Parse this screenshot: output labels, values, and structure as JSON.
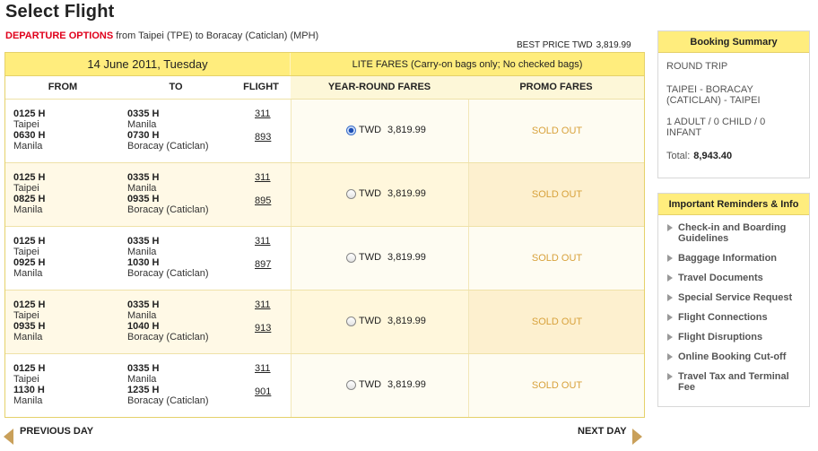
{
  "page": {
    "title": "Select Flight"
  },
  "departure": {
    "label": "DEPARTURE OPTIONS",
    "route": " from Taipei (TPE) to Boracay (Caticlan) (MPH)"
  },
  "best_price": {
    "label": "BEST PRICE TWD",
    "value": "3,819.99"
  },
  "table": {
    "date": "14 June 2011, Tuesday",
    "lite_fares": "LITE FARES (Carry-on bags only; No checked bags)",
    "headers": {
      "from": "FROM",
      "to": "TO",
      "flight": "FLIGHT",
      "year_round": "YEAR-ROUND FARES",
      "promo": "PROMO FARES"
    },
    "rows": [
      {
        "dep1_time": "0125 H",
        "dep1_city": "Taipei",
        "dep2_time": "0630 H",
        "dep2_city": "Manila",
        "arr1_time": "0335 H",
        "arr1_city": "Manila",
        "arr2_time": "0730 H",
        "arr2_city": "Boracay (Caticlan)",
        "flight1": "311",
        "flight2": "893",
        "currency": "TWD",
        "fare": "3,819.99",
        "selected": true,
        "promo": "SOLD OUT"
      },
      {
        "dep1_time": "0125 H",
        "dep1_city": "Taipei",
        "dep2_time": "0825 H",
        "dep2_city": "Manila",
        "arr1_time": "0335 H",
        "arr1_city": "Manila",
        "arr2_time": "0935 H",
        "arr2_city": "Boracay (Caticlan)",
        "flight1": "311",
        "flight2": "895",
        "currency": "TWD",
        "fare": "3,819.99",
        "selected": false,
        "promo": "SOLD OUT"
      },
      {
        "dep1_time": "0125 H",
        "dep1_city": "Taipei",
        "dep2_time": "0925 H",
        "dep2_city": "Manila",
        "arr1_time": "0335 H",
        "arr1_city": "Manila",
        "arr2_time": "1030 H",
        "arr2_city": "Boracay (Caticlan)",
        "flight1": "311",
        "flight2": "897",
        "currency": "TWD",
        "fare": "3,819.99",
        "selected": false,
        "promo": "SOLD OUT"
      },
      {
        "dep1_time": "0125 H",
        "dep1_city": "Taipei",
        "dep2_time": "0935 H",
        "dep2_city": "Manila",
        "arr1_time": "0335 H",
        "arr1_city": "Manila",
        "arr2_time": "1040 H",
        "arr2_city": "Boracay (Caticlan)",
        "flight1": "311",
        "flight2": "913",
        "currency": "TWD",
        "fare": "3,819.99",
        "selected": false,
        "promo": "SOLD OUT"
      },
      {
        "dep1_time": "0125 H",
        "dep1_city": "Taipei",
        "dep2_time": "1130 H",
        "dep2_city": "Manila",
        "arr1_time": "0335 H",
        "arr1_city": "Manila",
        "arr2_time": "1235 H",
        "arr2_city": "Boracay (Caticlan)",
        "flight1": "311",
        "flight2": "901",
        "currency": "TWD",
        "fare": "3,819.99",
        "selected": false,
        "promo": "SOLD OUT"
      }
    ]
  },
  "nav": {
    "prev": "PREVIOUS DAY",
    "next": "NEXT DAY"
  },
  "summary": {
    "title": "Booking Summary",
    "trip_type": "ROUND TRIP",
    "route": "TAIPEI - BORACAY (CATICLAN) - TAIPEI",
    "passengers": "1 ADULT / 0 CHILD / 0 INFANT",
    "total_label": "Total:",
    "total_value": "8,943.40"
  },
  "reminders": {
    "title": "Important Reminders & Info",
    "items": [
      "Check-in and Boarding Guidelines",
      "Baggage Information",
      "Travel Documents",
      "Special Service Request",
      "Flight Connections",
      "Flight Disruptions",
      "Online Booking Cut-off",
      "Travel Tax and Terminal Fee"
    ]
  },
  "colors": {
    "accent_red": "#e0001b",
    "header_yellow": "#ffed7d",
    "sold_out": "#d8a23c",
    "nav_arrow": "#c9a05a"
  },
  "icons": {
    "selected_radio": "radio-selected-icon",
    "radio": "radio-icon",
    "prev": "arrow-left-icon",
    "next": "arrow-right-icon",
    "bullet": "triangle-bullet-icon"
  }
}
